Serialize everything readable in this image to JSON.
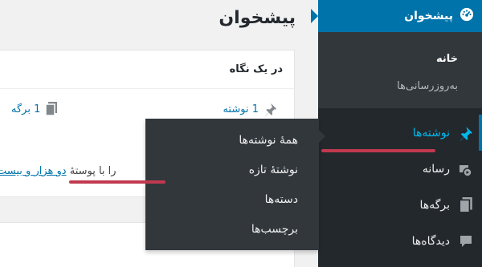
{
  "page": {
    "title": "پیشخوان"
  },
  "glance": {
    "title": "در یک نگاه",
    "posts_count": "1 نوشته",
    "pages_count": "1 برگه",
    "theme_line_prefix": "را با پوستهٔ",
    "theme_link": "دو هزار و بیست"
  },
  "sidebar": {
    "dashboard_label": "پیشخوان",
    "sub_home": "خانه",
    "sub_updates": "به‌روزرسانی‌ها",
    "items": [
      {
        "label": "نوشته‌ها",
        "icon": "pushpin-icon"
      },
      {
        "label": "رسانه",
        "icon": "media-icon"
      },
      {
        "label": "برگه‌ها",
        "icon": "pages-icon"
      },
      {
        "label": "دیدگاه‌ها",
        "icon": "comment-icon"
      }
    ]
  },
  "flyout": {
    "items": [
      "همهٔ نوشته‌ها",
      "نوشتهٔ تازه",
      "دسته‌ها",
      "برچسب‌ها"
    ]
  },
  "colors": {
    "sidebar_bg": "#23282d",
    "submenu_bg": "#32373c",
    "accent": "#0073aa",
    "current_text": "#00b9eb",
    "highlight_underline": "#c0394f",
    "link": "#0073aa"
  }
}
